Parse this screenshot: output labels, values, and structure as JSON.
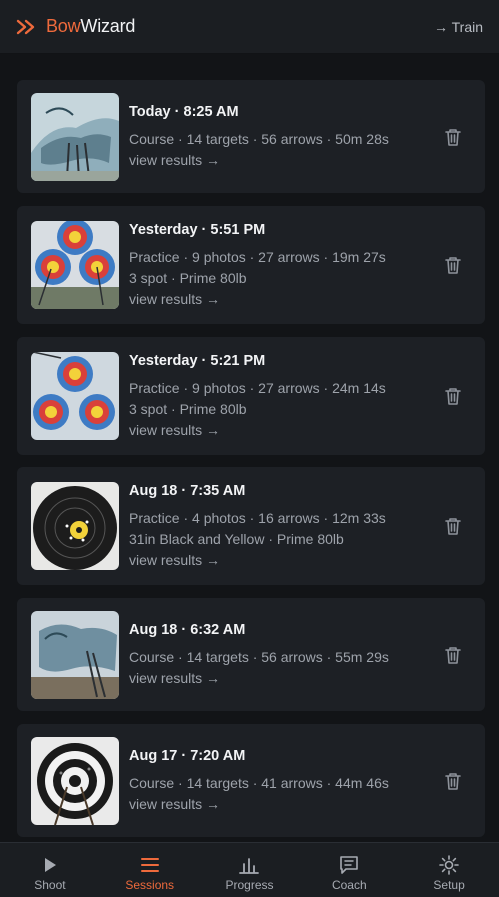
{
  "header": {
    "brand_part1": "Bow",
    "brand_part2": "Wizard",
    "train_label": "→ Train"
  },
  "sessions": [
    {
      "when": "Today · 8:25 AM",
      "meta1": "Course · 14 targets · 56 arrows · 50m 28s",
      "meta2": "",
      "view": "view results →",
      "thumb": "goat"
    },
    {
      "when": "Yesterday · 5:51 PM",
      "meta1": "Practice · 9 photos · 27 arrows · 19m 27s",
      "meta2": "3 spot · Prime 80lb",
      "view": "view results →",
      "thumb": "3spot"
    },
    {
      "when": "Yesterday · 5:21 PM",
      "meta1": "Practice · 9 photos · 27 arrows · 24m 14s",
      "meta2": "3 spot · Prime 80lb",
      "view": "view results →",
      "thumb": "3spot"
    },
    {
      "when": "Aug 18 · 7:35 AM",
      "meta1": "Practice · 4 photos · 16 arrows · 12m 33s",
      "meta2": "31in Black and Yellow · Prime 80lb",
      "view": "view results →",
      "thumb": "black"
    },
    {
      "when": "Aug 18 · 6:32 AM",
      "meta1": "Course · 14 targets · 56 arrows · 55m 29s",
      "meta2": "",
      "view": "view results →",
      "thumb": "goat"
    },
    {
      "when": "Aug 17 · 7:20 AM",
      "meta1": "Course · 14 targets · 41 arrows · 44m 46s",
      "meta2": "",
      "view": "view results →",
      "thumb": "rings"
    }
  ],
  "nav": {
    "items": [
      {
        "label": "Shoot",
        "icon": "play-icon"
      },
      {
        "label": "Sessions",
        "icon": "menu-icon"
      },
      {
        "label": "Progress",
        "icon": "bar-chart-icon"
      },
      {
        "label": "Coach",
        "icon": "chat-icon"
      },
      {
        "label": "Setup",
        "icon": "sun-gear-icon"
      }
    ],
    "active": "Sessions"
  },
  "colors": {
    "accent": "#ee6a3c",
    "background": "#121417",
    "card": "#1d2025",
    "muted_text": "#9ea3ab"
  }
}
